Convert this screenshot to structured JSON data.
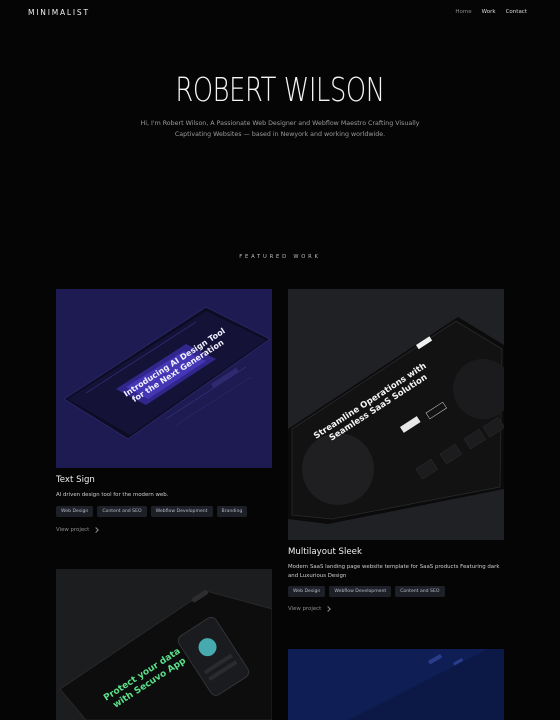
{
  "nav": {
    "logo": "MINIMALIST",
    "links": [
      "Home",
      "Work",
      "Contact"
    ]
  },
  "hero": {
    "title": "ROBERT WILSON",
    "subtitle": "Hi, I'm Robert Wilson, A Passionate Web Designer and Webflow Maestro Crafting Visually Captivating Websites — based in Newyork and working worldwide."
  },
  "featured": {
    "label": "FEATURED WORK",
    "projects": [
      {
        "title": "Text Sign",
        "description": "AI driven design tool for the modern web.",
        "tags": [
          "Web Design",
          "Content and SEO",
          "Webflow Development",
          "Branding"
        ],
        "view": "View project",
        "mockup_headline": [
          "Introducing AI Design Tool",
          "for the Next Generation"
        ]
      },
      {
        "title": "Multilayout Sleek",
        "description": "Modern SaaS landing page website template for SaaS products Featuring dark and Luxurious Design",
        "tags": [
          "Web Design",
          "Webflow Development",
          "Content and SEO"
        ],
        "view": "View project",
        "mockup_headline": [
          "Streamline Operations with",
          "Seamless SaaS Solution"
        ]
      },
      {
        "mockup_headline": [
          "Protect your data",
          "with Secuvo App"
        ]
      },
      {}
    ]
  },
  "colors": {
    "background": "#050505",
    "card1": "#1e1a52",
    "card2": "#202124",
    "card3": "#1c1d1f",
    "card4": "#0f1f55",
    "tag_bg": "#1d2027"
  }
}
